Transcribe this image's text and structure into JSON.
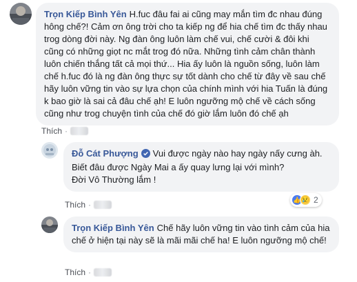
{
  "comments": [
    {
      "author": "Trọn Kiếp Bình Yên",
      "text": "H.fuc đâu fai ai cũng may mắn tìm đc nhau đúng hông chế?! Cảm ơn ông trời cho ta kiếp ng để hia chế tìm đc thấy nhau trog dòng đời này. Ng đàn ông luôn làm chế vui, chế cười & đôi khi cũng có những giọt nc mắt trog đó nữa. Những tình cảm chân thành luôn chiến thắng tất cả mọi thứ... Hia ấy luôn là nguồn sống, luôn làm chế h.fuc đó là ng đàn ông thực sự tốt dành cho chế từ đây về sau chế hãy luôn vững tin vào sự lựa chọn của chính mình với hia Tuấn là đúng k bao giờ là sai cả đâu chế ạh! E luôn ngưỡng mộ chế về cách sống cũng như trog chuyện tình của chế đó giờ lắm luôn đó chế ạh",
      "like_label": "Thích"
    },
    {
      "author": "Đỗ Cát Phượng",
      "verified": true,
      "text": "Vui được ngày nào hay ngày nấy cưng àh.\nBiết đâu được Ngày Mai a ấy quay lưng lại với mình?\nĐời Vô Thường lắm !",
      "like_label": "Thích",
      "reactions": {
        "types": [
          "like",
          "sad"
        ],
        "count": "2"
      }
    },
    {
      "author": "Trọn Kiếp Bình Yên",
      "text": "Chế hãy luôn vững tin vào tình cảm của hia chế ở hiện tại này sẽ là mãi mãi chế ha! E luôn ngưỡng mộ chế!",
      "like_label": "Thích"
    }
  ],
  "colors": {
    "author": "#385898",
    "bubble": "#f2f3f5",
    "verified": "#4267b2",
    "like_reaction": "#4a7bf0",
    "sad_reaction": "#f7d154"
  },
  "icons": {
    "verified": "verified-badge-icon",
    "like": "like-reaction-icon",
    "sad": "sad-reaction-icon"
  }
}
